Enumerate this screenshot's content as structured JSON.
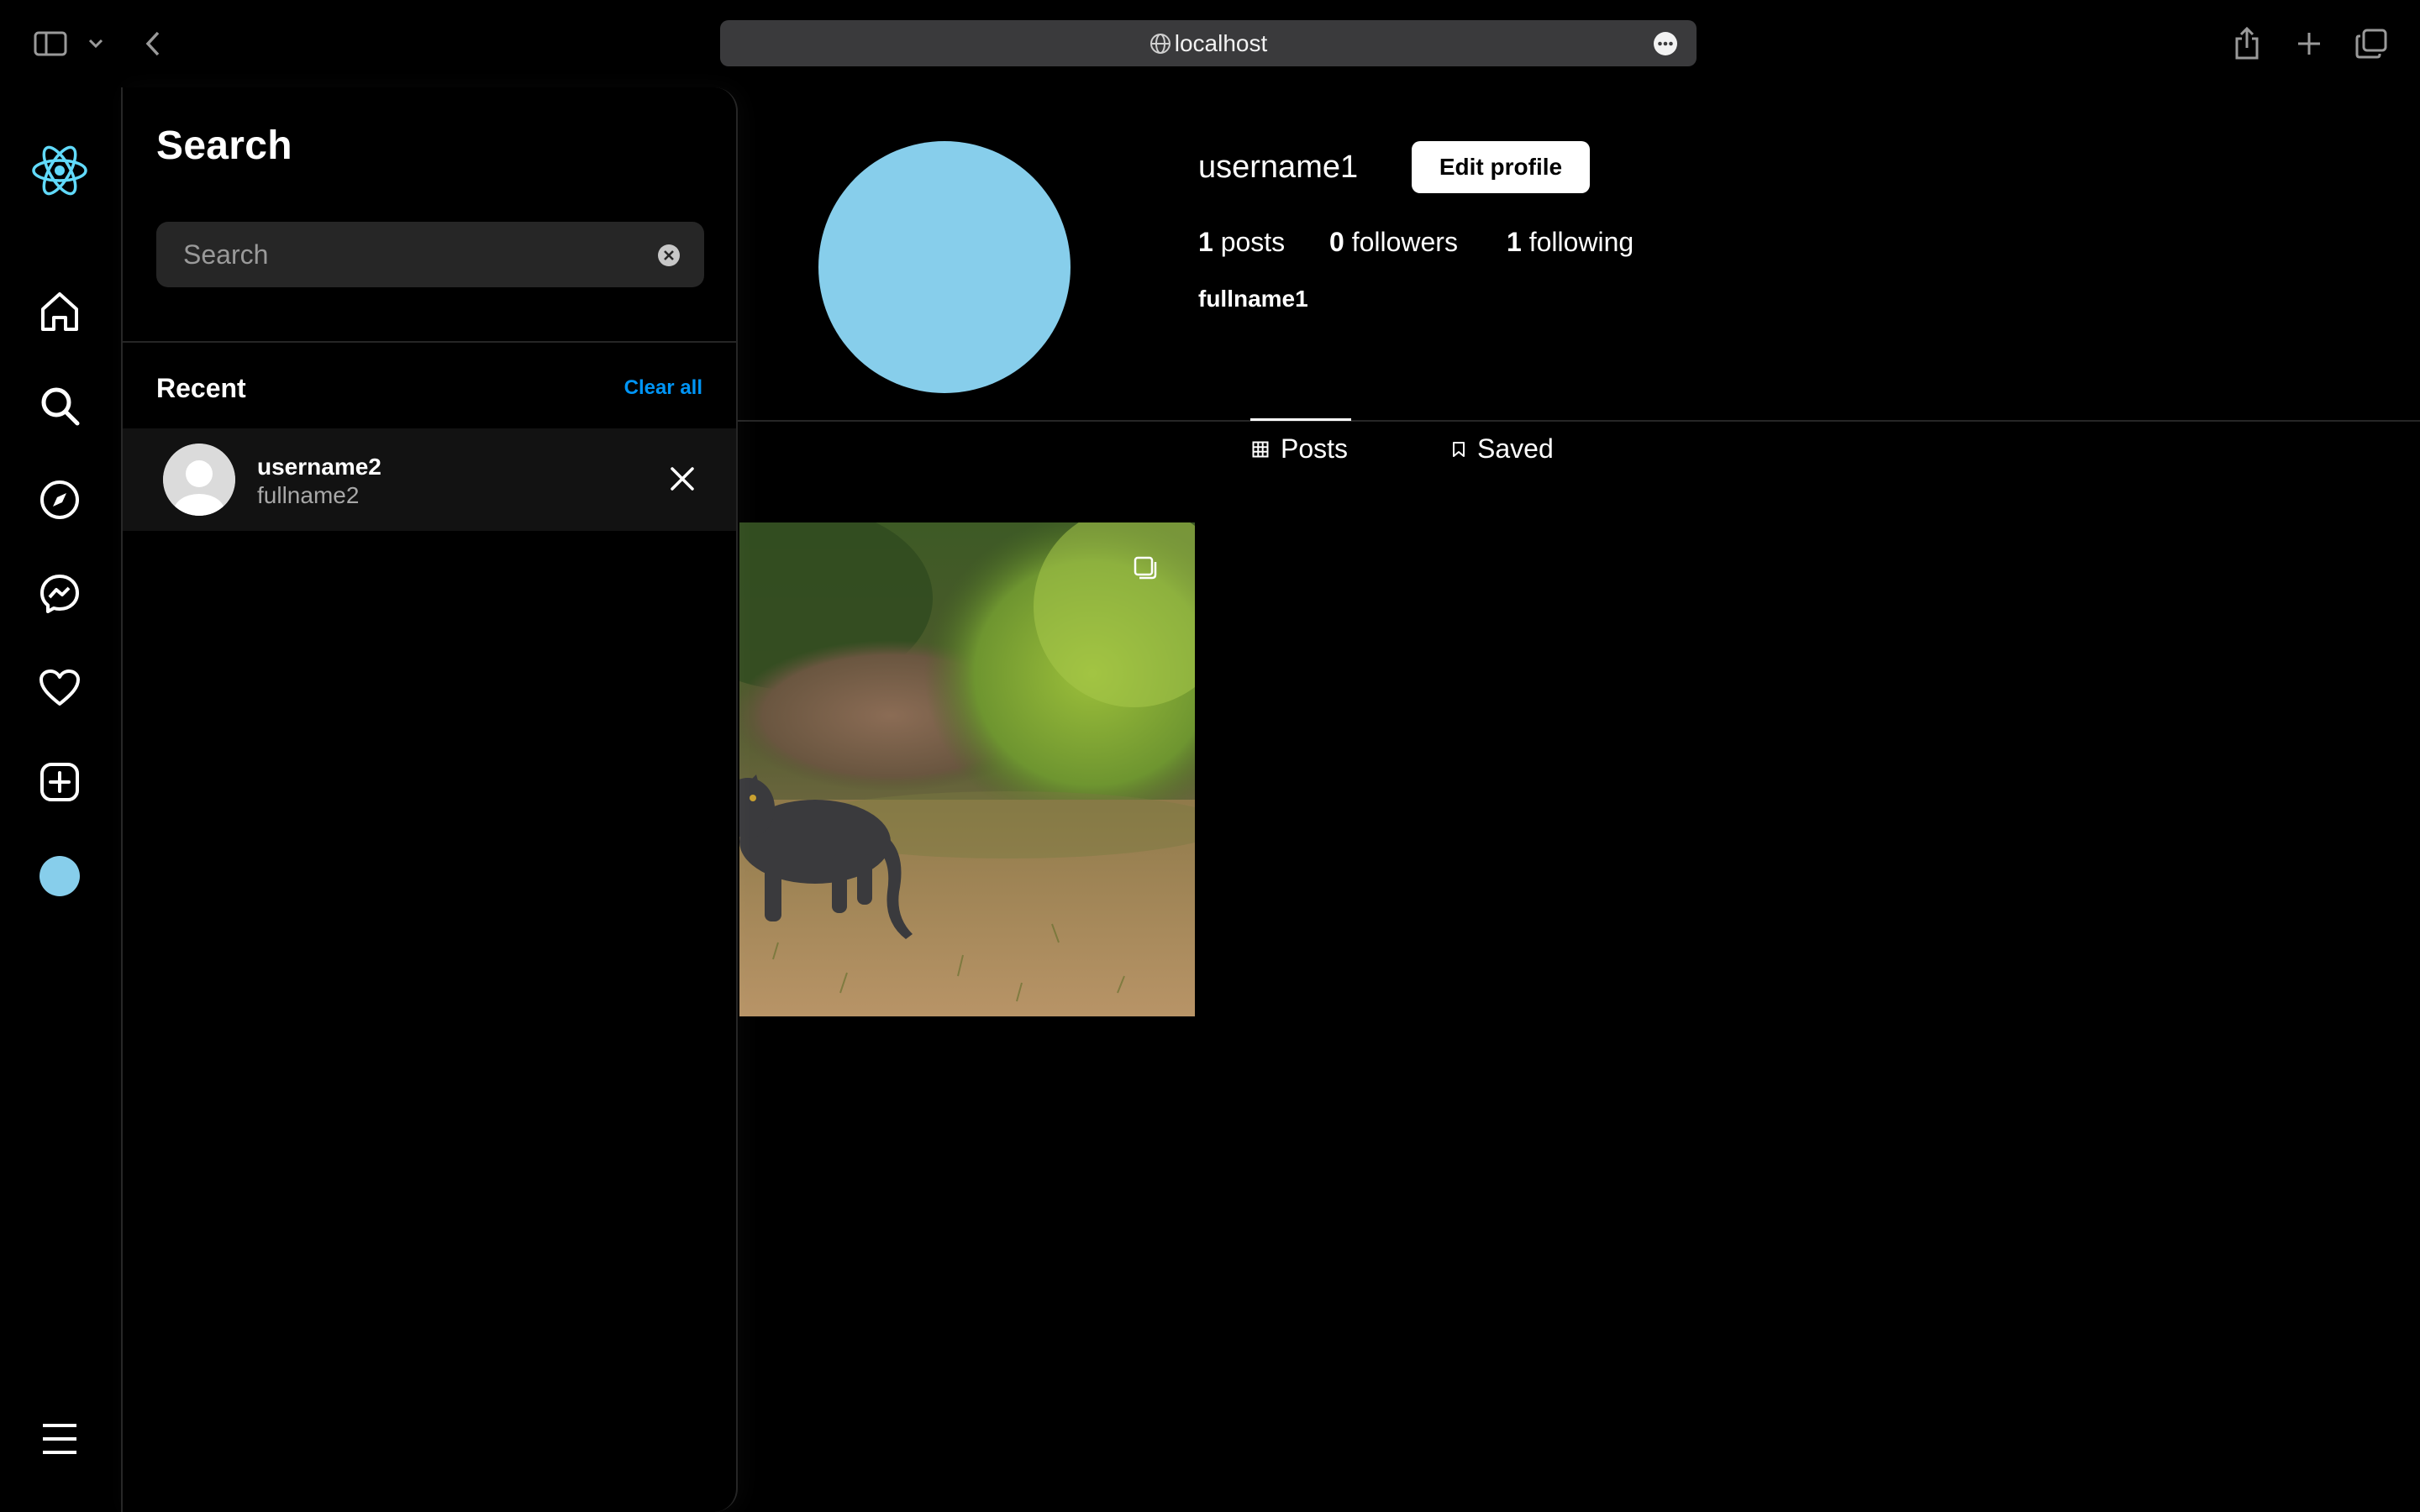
{
  "browser": {
    "address": "localhost"
  },
  "rail": {
    "items": [
      {
        "icon": "react-logo-icon"
      },
      {
        "icon": "home-icon"
      },
      {
        "icon": "search-icon"
      },
      {
        "icon": "explore-icon"
      },
      {
        "icon": "messenger-icon"
      },
      {
        "icon": "heart-icon"
      },
      {
        "icon": "create-icon"
      },
      {
        "icon": "profile-avatar-icon"
      },
      {
        "icon": "menu-icon"
      }
    ]
  },
  "search": {
    "title": "Search",
    "placeholder": "Search",
    "recent_label": "Recent",
    "clear_all": "Clear all",
    "recent": [
      {
        "username": "username2",
        "fullname": "fullname2"
      }
    ]
  },
  "profile": {
    "username": "username1",
    "edit_label": "Edit profile",
    "posts_count": "1",
    "posts_label": "posts",
    "followers_count": "0",
    "followers_label": "followers",
    "following_count": "1",
    "following_label": "following",
    "fullname": "fullname1",
    "avatar_color": "#87ceeb"
  },
  "tabs": {
    "posts": "Posts",
    "saved": "Saved"
  },
  "colors": {
    "accent": "#0095f6",
    "react": "#61dafb"
  }
}
